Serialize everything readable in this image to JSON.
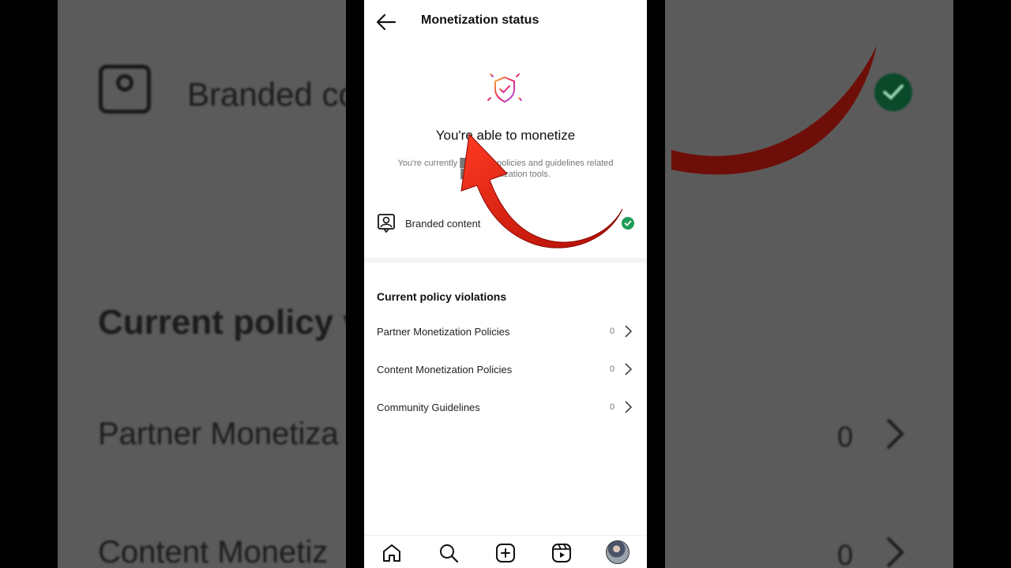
{
  "backdrop": {
    "branded_label": "Branded co",
    "heading": "Current policy v",
    "partner_label": "Partner Monetiza",
    "content_label": "Content Monetiz",
    "zero": "0"
  },
  "header": {
    "title": "Monetization status",
    "back_icon": "arrow-left-icon"
  },
  "hero": {
    "icon": "shield-check-icon",
    "headline": "You're able to monetize",
    "subtext": "You're currently █████ll policies and guidelines related ████onetization tools."
  },
  "eligibility": [
    {
      "label": "Branded content",
      "icon": "person-frame-icon",
      "status": "eligible",
      "status_color": "#1f9d55"
    }
  ],
  "violations": {
    "title": "Current policy violations",
    "items": [
      {
        "label": "Partner Monetization Policies",
        "count": "0"
      },
      {
        "label": "Content Monetization Policies",
        "count": "0"
      },
      {
        "label": "Community Guidelines",
        "count": "0"
      }
    ]
  },
  "nav": [
    "home-icon",
    "search-icon",
    "create-icon",
    "reels-icon",
    "profile-avatar"
  ],
  "colors": {
    "accent_green": "#1f9d55",
    "arrow_red": "#e01b0b",
    "shield_gradient": [
      "#f7b733",
      "#e91e63",
      "#a855f7"
    ]
  }
}
